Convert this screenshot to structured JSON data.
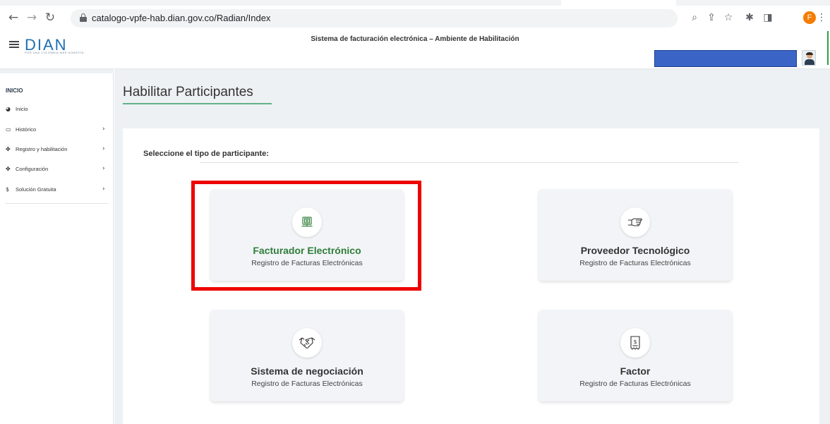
{
  "browser": {
    "url": "catalogo-vpfe-hab.dian.gov.co/Radian/Index",
    "profile_initial": "F"
  },
  "header": {
    "logo_text": "DIAN",
    "logo_subtext": "POR UNA COLOMBIA MÁS HONESTA",
    "title": "Sistema de facturación electrónica – Ambiente de Habilitación"
  },
  "sidebar": {
    "heading": "INICIO",
    "items": [
      {
        "label": "Inicio",
        "icon": "dashboard-icon"
      },
      {
        "label": "Histórico",
        "icon": "laptop-icon"
      },
      {
        "label": "Registro y habilitación",
        "icon": "users-icon"
      },
      {
        "label": "Configuración",
        "icon": "users-icon"
      },
      {
        "label": "Solución Gratuita",
        "icon": "dollar-icon"
      }
    ]
  },
  "main": {
    "page_title": "Habilitar Participantes",
    "prompt": "Seleccione el tipo de participante:",
    "cards": [
      {
        "title": "Facturador Electrónico",
        "subtitle": "Registro de Facturas Electrónicas",
        "icon": "computer-icon"
      },
      {
        "title": "Proveedor Tecnológico",
        "subtitle": "Registro de Facturas Electrónicas",
        "icon": "hand-icon"
      },
      {
        "title": "Sistema de negociación",
        "subtitle": "Registro de Facturas Electrónicas",
        "icon": "handshake-icon"
      },
      {
        "title": "Factor",
        "subtitle": "Registro de Facturas Electrónicas",
        "icon": "receipt-icon"
      }
    ]
  },
  "colors": {
    "accent_green": "#2f7d3a",
    "highlight_red": "#ee0000",
    "brand_blue": "#1f6fb3",
    "user_box_blue": "#3a65c7"
  }
}
